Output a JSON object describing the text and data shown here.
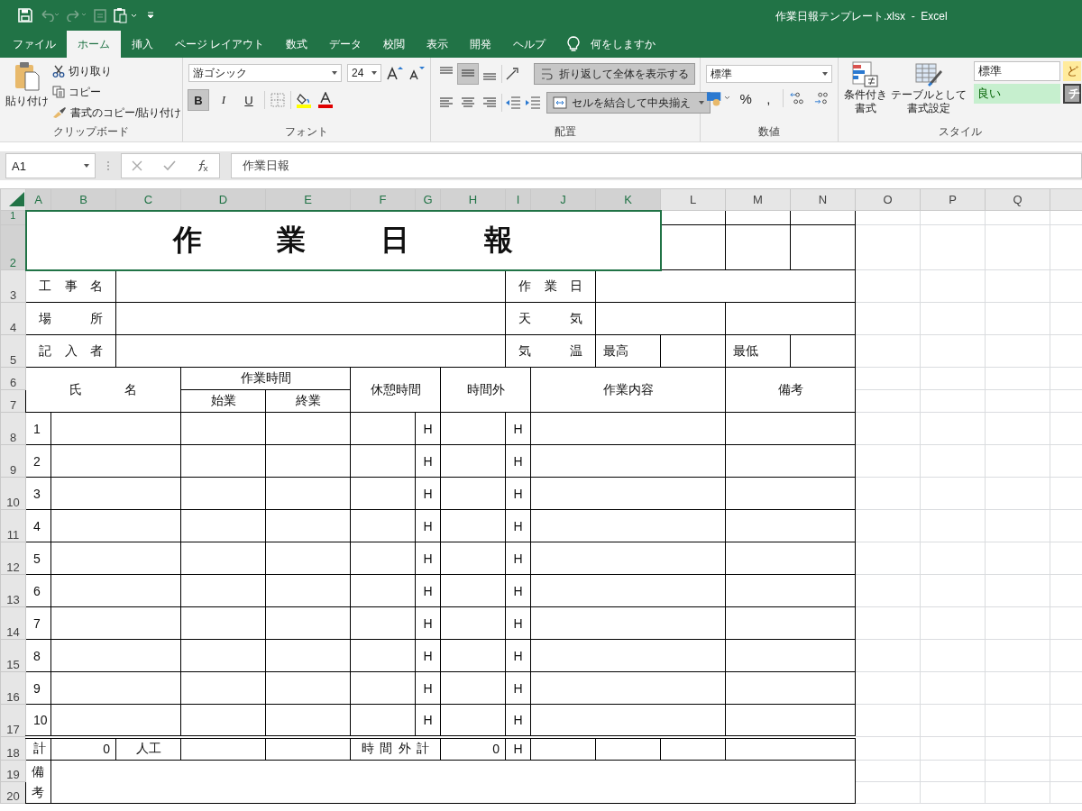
{
  "window": {
    "title": "作業日報テンプレート.xlsx  -  Excel"
  },
  "ribbon_tabs": [
    {
      "label": "ファイル",
      "selected": false
    },
    {
      "label": "ホーム",
      "selected": true
    },
    {
      "label": "挿入",
      "selected": false
    },
    {
      "label": "ページ レイアウト",
      "selected": false
    },
    {
      "label": "数式",
      "selected": false
    },
    {
      "label": "データ",
      "selected": false
    },
    {
      "label": "校閲",
      "selected": false
    },
    {
      "label": "表示",
      "selected": false
    },
    {
      "label": "開発",
      "selected": false
    },
    {
      "label": "ヘルプ",
      "selected": false
    }
  ],
  "tell_me": {
    "placeholder": "何をしますか"
  },
  "clipboard": {
    "paste": "貼り付け",
    "cut": "切り取り",
    "copy": "コピー",
    "format_painter": "書式のコピー/貼り付け",
    "group_label": "クリップボード"
  },
  "font": {
    "name": "游ゴシック",
    "size": "24",
    "group_label": "フォント",
    "buttons": [
      {
        "label": "B",
        "selected": true
      },
      {
        "label": "I",
        "selected": false
      },
      {
        "label": "U",
        "selected": false
      }
    ]
  },
  "alignment": {
    "vertical": [
      {
        "kind": "top",
        "selected": false
      },
      {
        "kind": "middle",
        "selected": true
      },
      {
        "kind": "bottom",
        "selected": false
      }
    ],
    "horizontal": [
      {
        "kind": "left",
        "selected": false
      },
      {
        "kind": "center",
        "selected": false
      },
      {
        "kind": "right",
        "selected": false
      }
    ],
    "wrap": {
      "label": "折り返して全体を表示する",
      "on": true
    },
    "merge": {
      "label": "セルを結合して中央揃え",
      "on": true
    },
    "group_label": "配置"
  },
  "number": {
    "format": "標準",
    "percent": "%",
    "comma": ",",
    "group_label": "数値"
  },
  "styles": {
    "conditional": [
      "条件付き",
      "書式"
    ],
    "as_table": [
      "テーブルとして",
      "書式設定"
    ],
    "cells": [
      {
        "label": "標準",
        "kind": "normal"
      },
      {
        "label": "ど",
        "kind": "neutral"
      },
      {
        "label": "良い",
        "kind": "good"
      },
      {
        "label": "チ",
        "kind": "check"
      }
    ],
    "group_label": "スタイル"
  },
  "formula_bar": {
    "name_box": "A1",
    "value": "作業日報"
  },
  "columns": [
    {
      "label": "A",
      "selected": true
    },
    {
      "label": "B",
      "selected": true
    },
    {
      "label": "C",
      "selected": true
    },
    {
      "label": "D",
      "selected": true
    },
    {
      "label": "E",
      "selected": true
    },
    {
      "label": "F",
      "selected": true
    },
    {
      "label": "G",
      "selected": true
    },
    {
      "label": "H",
      "selected": true
    },
    {
      "label": "I",
      "selected": true
    },
    {
      "label": "J",
      "selected": true
    },
    {
      "label": "K",
      "selected": true
    },
    {
      "label": "L",
      "selected": false
    },
    {
      "label": "M",
      "selected": false
    },
    {
      "label": "N",
      "selected": false
    },
    {
      "label": "O",
      "selected": false
    },
    {
      "label": "P",
      "selected": false
    },
    {
      "label": "Q",
      "selected": false
    }
  ],
  "rows": [
    {
      "label": "1",
      "selected": true
    },
    {
      "label": "2",
      "selected": true
    },
    {
      "label": "3",
      "selected": false
    },
    {
      "label": "4",
      "selected": false
    },
    {
      "label": "5",
      "selected": false
    },
    {
      "label": "6",
      "selected": false
    },
    {
      "label": "7",
      "selected": false
    },
    {
      "label": "8",
      "selected": false
    },
    {
      "label": "9",
      "selected": false
    },
    {
      "label": "10",
      "selected": false
    },
    {
      "label": "11",
      "selected": false
    },
    {
      "label": "12",
      "selected": false
    },
    {
      "label": "13",
      "selected": false
    },
    {
      "label": "14",
      "selected": false
    },
    {
      "label": "15",
      "selected": false
    },
    {
      "label": "16",
      "selected": false
    },
    {
      "label": "17",
      "selected": false
    },
    {
      "label": "18",
      "selected": false
    },
    {
      "label": "19",
      "selected": false
    },
    {
      "label": "20",
      "selected": false
    }
  ],
  "sheet": {
    "title": "作業日報",
    "info_left": [
      "工事名",
      "場所",
      "記入者"
    ],
    "info_right": [
      "作業日",
      "天気",
      "気温"
    ],
    "temperature": {
      "high": "最高",
      "low": "最低"
    },
    "headers": {
      "name": "氏名",
      "work_time": "作業時間",
      "start": "始業",
      "end": "終業",
      "break": "休憩時間",
      "overtime": "時間外",
      "content": "作業内容",
      "notes": "備考"
    },
    "entries": [
      {
        "no": "1",
        "break_unit": "H",
        "overtime_unit": "H"
      },
      {
        "no": "2",
        "break_unit": "H",
        "overtime_unit": "H"
      },
      {
        "no": "3",
        "break_unit": "H",
        "overtime_unit": "H"
      },
      {
        "no": "4",
        "break_unit": "H",
        "overtime_unit": "H"
      },
      {
        "no": "5",
        "break_unit": "H",
        "overtime_unit": "H"
      },
      {
        "no": "6",
        "break_unit": "H",
        "overtime_unit": "H"
      },
      {
        "no": "7",
        "break_unit": "H",
        "overtime_unit": "H"
      },
      {
        "no": "8",
        "break_unit": "H",
        "overtime_unit": "H"
      },
      {
        "no": "9",
        "break_unit": "H",
        "overtime_unit": "H"
      },
      {
        "no": "10",
        "break_unit": "H",
        "overtime_unit": "H"
      }
    ],
    "totals": {
      "label": "計",
      "count": "0",
      "count_unit": "人工",
      "overtime_label": "時間外計",
      "overtime": "0",
      "overtime_unit": "H"
    },
    "remarks": {
      "label": "備考"
    }
  }
}
